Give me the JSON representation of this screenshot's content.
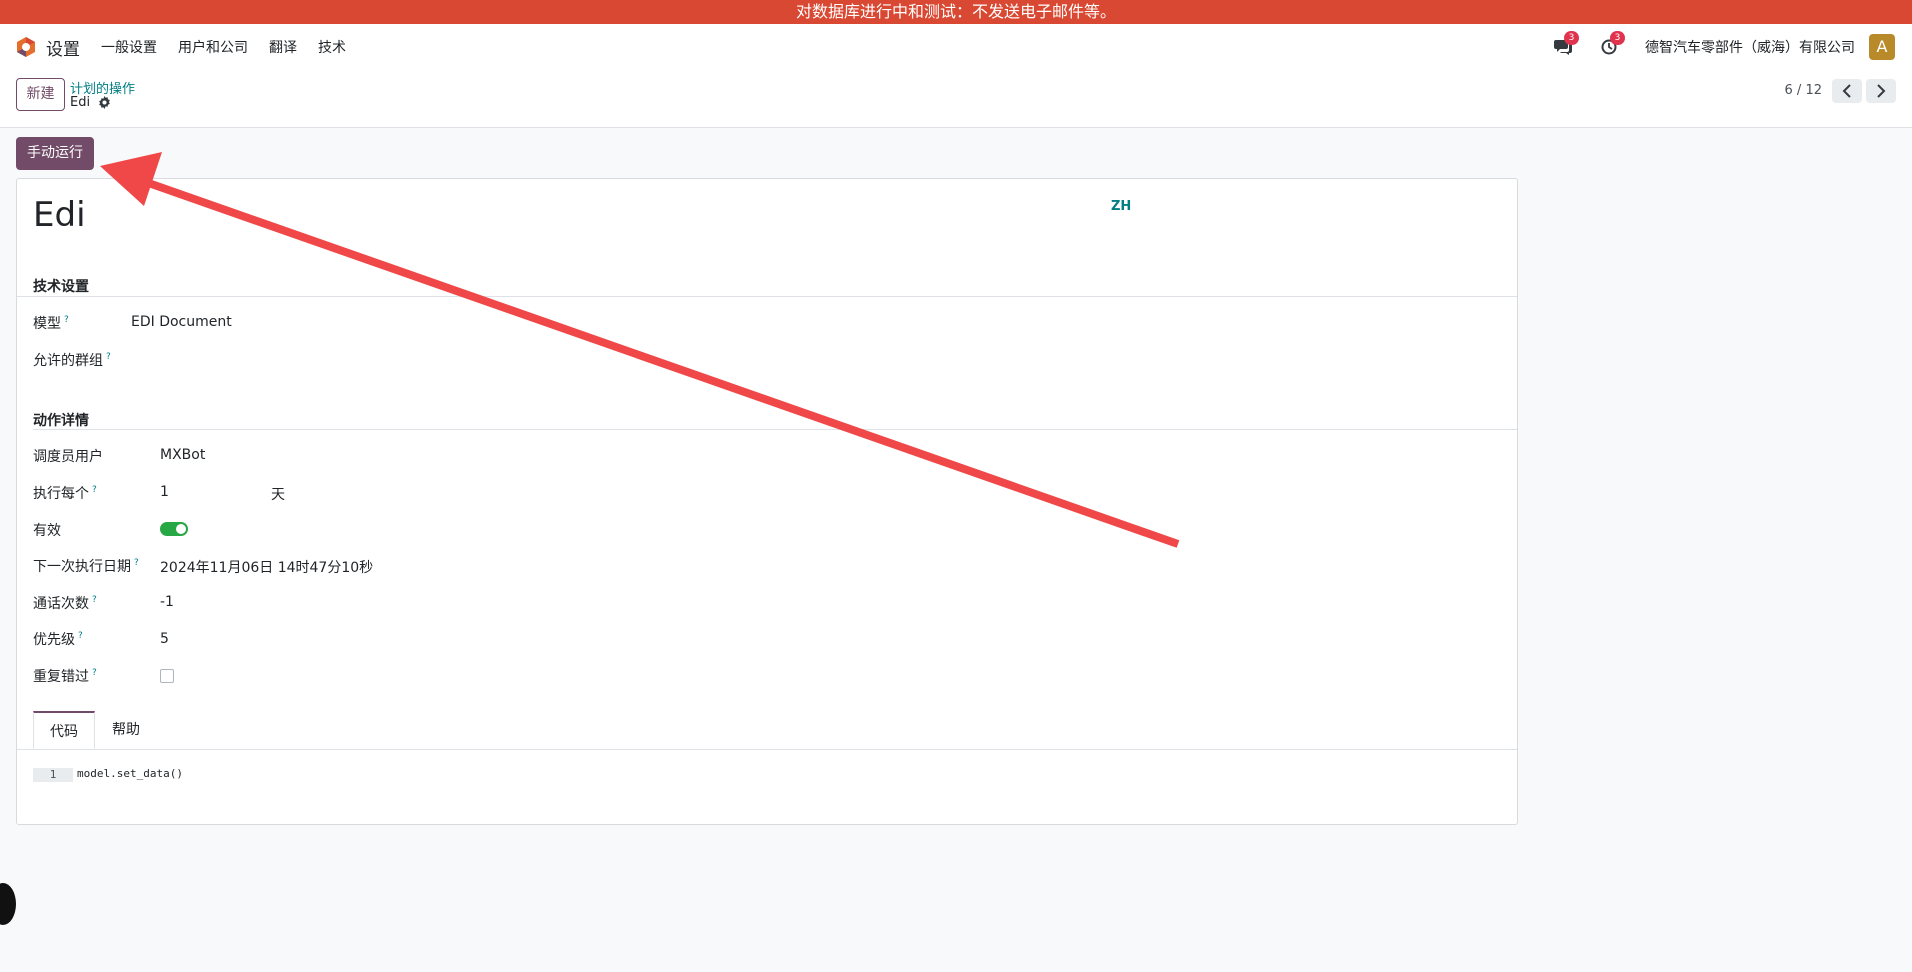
{
  "banner": {
    "text": "对数据库进行中和测试：不发送电子邮件等。"
  },
  "navbar": {
    "app_name": "设置",
    "menu": [
      "一般设置",
      "用户和公司",
      "翻译",
      "技术"
    ],
    "messages_badge": "3",
    "activities_badge": "3",
    "company": "德智汽车零部件（威海）有限公司",
    "avatar_letter": "A"
  },
  "control_panel": {
    "new_label": "新建",
    "breadcrumb_parent": "计划的操作",
    "breadcrumb_current": "Edi",
    "pager": "6 / 12"
  },
  "run_button_label": "手动运行",
  "record": {
    "title": "Edi",
    "lang": "ZH",
    "tech_section": "技术设置",
    "model_label": "模型",
    "model_value": "EDI Document",
    "groups_label": "允许的群组",
    "action_section": "动作详情",
    "scheduler_user_label": "调度员用户",
    "scheduler_user_value": "MXBot",
    "interval_label": "执行每个",
    "interval_number": "1",
    "interval_unit": "天",
    "active_label": "有效",
    "active": true,
    "nextcall_label": "下一次执行日期",
    "nextcall_value": "2024年11月06日 14时47分10秒",
    "numbercall_label": "通话次数",
    "numbercall_value": "-1",
    "priority_label": "优先级",
    "priority_value": "5",
    "doall_label": "重复错过",
    "doall": false,
    "help_mark": "?"
  },
  "tabs": {
    "code": "代码",
    "help": "帮助"
  },
  "code": {
    "line_number": "1",
    "content": "model.set_data()"
  },
  "colors": {
    "banner": "#d94832",
    "primary": "#714b67",
    "link": "#017e84",
    "annotation_arrow": "#f04848"
  }
}
